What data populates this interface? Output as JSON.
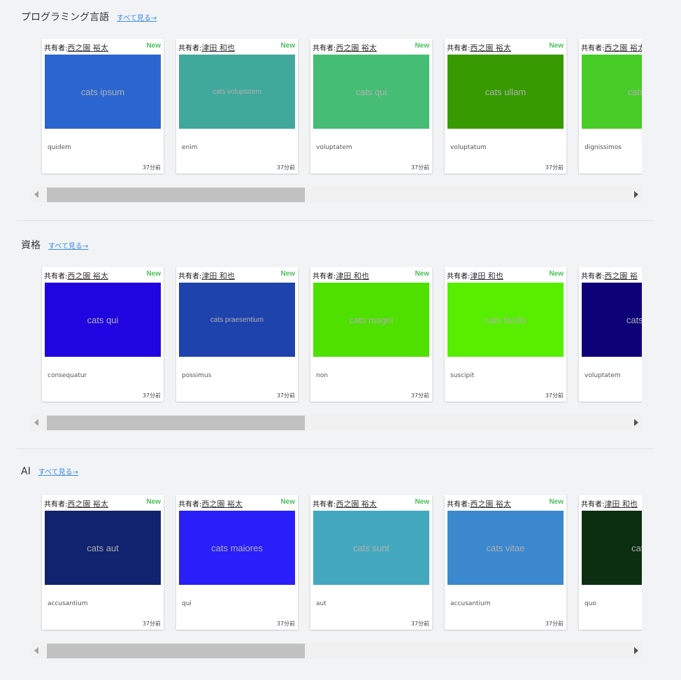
{
  "see_all_label": "すべて見る→",
  "owner_prefix": "共有者:",
  "sections": [
    {
      "title": "プログラミング言語",
      "cards": [
        {
          "owner": "西之園 裕太",
          "new": "New",
          "thumb": "cats ipsum",
          "color": "#2b66d0",
          "desc": "quidem",
          "ago": "37分前"
        },
        {
          "owner": "津田 和也",
          "new": "New",
          "thumb": "cats voluptatem",
          "color": "#41a89c",
          "desc": "enim",
          "ago": "37分前"
        },
        {
          "owner": "西之園 裕太",
          "new": "New",
          "thumb": "cats qui",
          "color": "#45bd75",
          "desc": "voluptatem",
          "ago": "37分前"
        },
        {
          "owner": "西之園 裕太",
          "new": "New",
          "thumb": "cats ullam",
          "color": "#379a00",
          "desc": "voluptatum",
          "ago": "37分前"
        },
        {
          "owner": "西之園 裕太",
          "new": "",
          "thumb": "cats d",
          "color": "#48cc28",
          "desc": "dignissimos",
          "ago": ""
        }
      ]
    },
    {
      "title": "資格",
      "cards": [
        {
          "owner": "西之園 裕太",
          "new": "New",
          "thumb": "cats qui",
          "color": "#2105e0",
          "desc": "consequatur",
          "ago": "37分前"
        },
        {
          "owner": "津田 和也",
          "new": "New",
          "thumb": "cats praesentium",
          "color": "#1f43ad",
          "desc": "possimus",
          "ago": "37分前"
        },
        {
          "owner": "津田 和也",
          "new": "New",
          "thumb": "cats magni",
          "color": "#4fe000",
          "desc": "non",
          "ago": "37分前"
        },
        {
          "owner": "津田 和也",
          "new": "New",
          "thumb": "cats facilis",
          "color": "#58ee00",
          "desc": "suscipit",
          "ago": "37分前"
        },
        {
          "owner": "西之園 裕",
          "new": "",
          "thumb": "cats m",
          "color": "#0e0178",
          "desc": "voluptatem",
          "ago": ""
        }
      ]
    },
    {
      "title": "AI",
      "cards": [
        {
          "owner": "西之園 裕太",
          "new": "New",
          "thumb": "cats aut",
          "color": "#11236f",
          "desc": "accusantium",
          "ago": "37分前"
        },
        {
          "owner": "西之園 裕太",
          "new": "New",
          "thumb": "cats maiores",
          "color": "#2a1ffa",
          "desc": "qui",
          "ago": "37分前"
        },
        {
          "owner": "西之園 裕太",
          "new": "New",
          "thumb": "cats sunt",
          "color": "#44a9be",
          "desc": "aut",
          "ago": "37分前"
        },
        {
          "owner": "西之園 裕太",
          "new": "New",
          "thumb": "cats vitae",
          "color": "#3b88cf",
          "desc": "accusantium",
          "ago": "37分前"
        },
        {
          "owner": "津田 和也",
          "new": "",
          "thumb": "cats",
          "color": "#0c2f12",
          "desc": "quo",
          "ago": ""
        }
      ]
    }
  ]
}
